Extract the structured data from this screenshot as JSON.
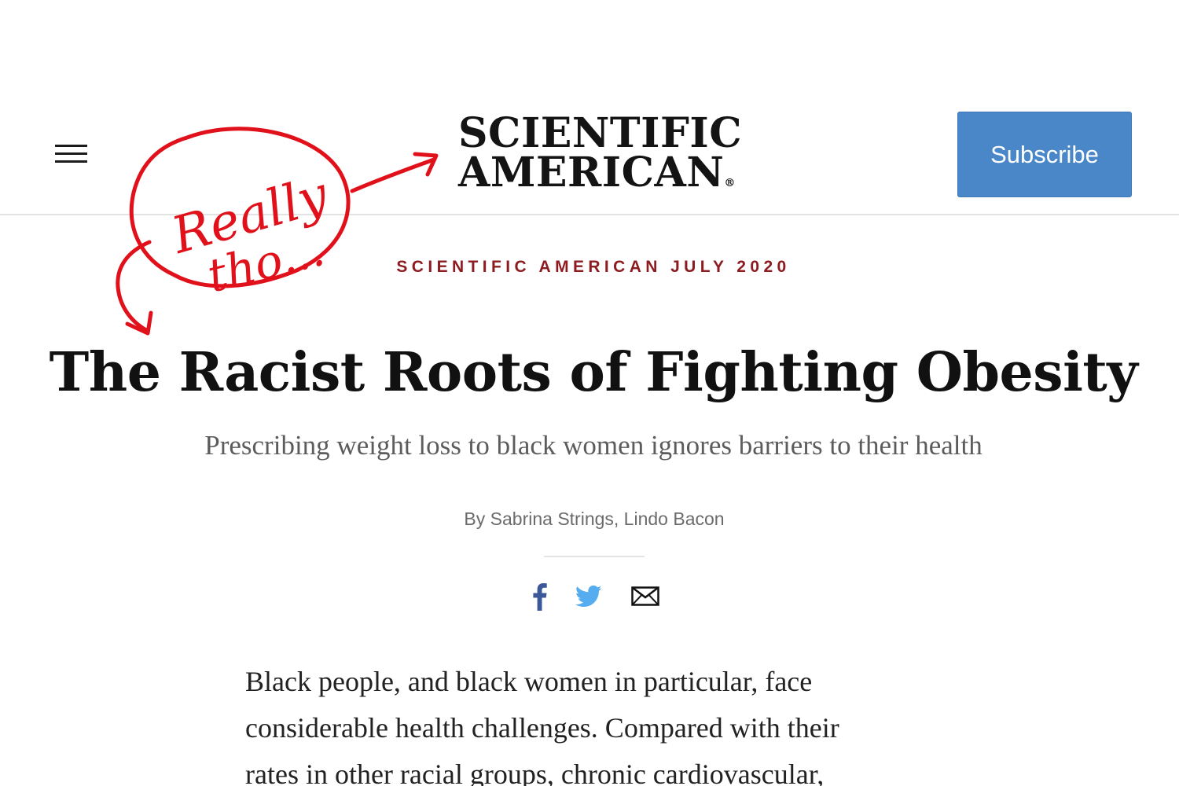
{
  "header": {
    "menu_icon": "hamburger-menu-icon",
    "logo_line1": "SCIENTIFIC",
    "logo_line2": "AMERICAN",
    "logo_mark": "®",
    "subscribe_label": "Subscribe",
    "subscribe_color": "#4a87c9"
  },
  "article": {
    "kicker": "SCIENTIFIC AMERICAN JULY 2020",
    "kicker_color": "#8d1c20",
    "headline": "The Racist Roots of Fighting Obesity",
    "dek": "Prescribing weight loss to black women ignores barriers to their health",
    "byline": "By Sabrina Strings, Lindo Bacon",
    "body_lines": [
      "Black people, and black women in particular, face",
      "considerable health challenges. Compared with their",
      "rates in other racial groups, chronic cardiovascular,"
    ]
  },
  "share": {
    "facebook_icon": "facebook-icon",
    "facebook_color": "#3b5998",
    "twitter_icon": "twitter-icon",
    "twitter_color": "#55acee",
    "email_icon": "email-icon"
  },
  "annotation": {
    "line1": "Really",
    "line2": "tho...",
    "color": "#e1111b"
  }
}
